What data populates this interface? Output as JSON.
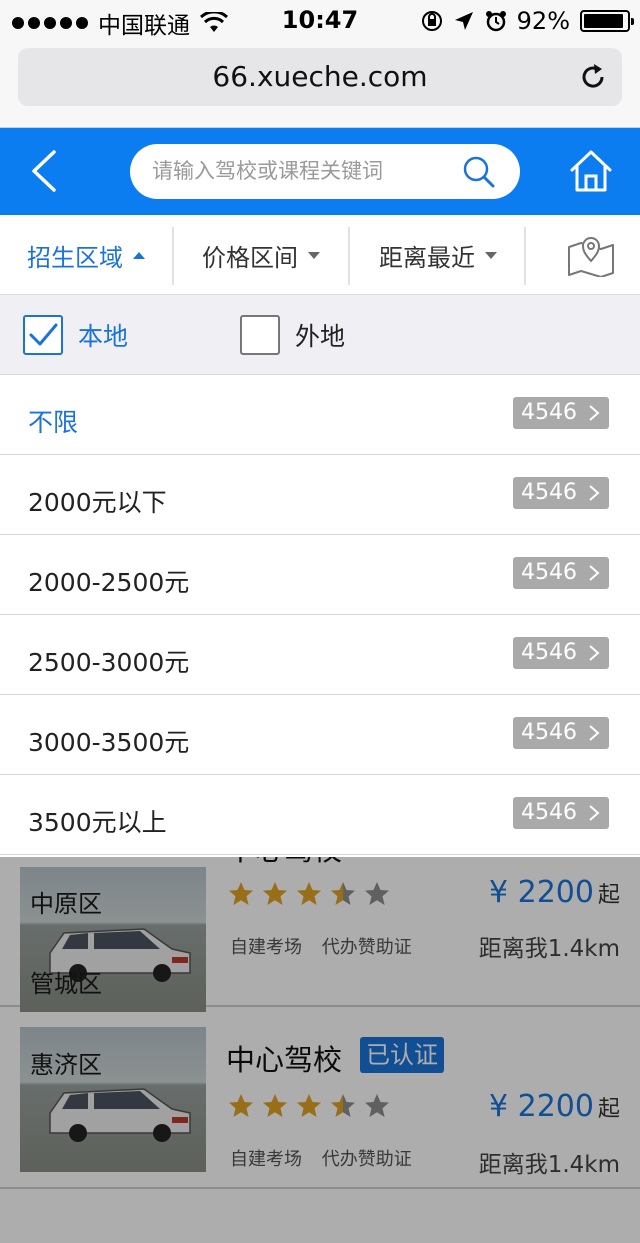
{
  "status_bar": {
    "carrier": "中国联通",
    "time": "10:47",
    "battery": "92%",
    "battery_level": 0.92
  },
  "browser": {
    "url": "66.xueche.com"
  },
  "header": {
    "search_placeholder": "请输入驾校或课程关键词"
  },
  "filters": {
    "tabs": [
      {
        "label": "招生区域"
      },
      {
        "label": "价格区间"
      },
      {
        "label": "距离最近"
      }
    ]
  },
  "location": {
    "local_label": "本地",
    "local_checked": true,
    "remote_label": "外地",
    "remote_checked": false
  },
  "options": [
    {
      "label": "不限",
      "count": "4546"
    },
    {
      "label": "2000元以下",
      "count": "4546"
    },
    {
      "label": "2000-2500元",
      "count": "4546"
    },
    {
      "label": "2500-3000元",
      "count": "4546"
    },
    {
      "label": "3000-3500元",
      "count": "4546"
    },
    {
      "label": "3500元以上",
      "count": "4546"
    }
  ],
  "listing": {
    "cards": [
      {
        "name": "中心驾校",
        "rating": 3.5,
        "tags": [
          "自建考场",
          "代办赞助证"
        ],
        "price": "¥ 2200",
        "price_suffix": "起",
        "distance": "距离我1.4km"
      },
      {
        "name": "中心驾校",
        "verified": "已认证",
        "rating": 3.5,
        "tags": [
          "自建考场",
          "代办赞助证"
        ],
        "price": "¥ 2200",
        "price_suffix": "起",
        "distance": "距离我1.4km"
      }
    ],
    "district_labels": [
      "中原区",
      "管城区",
      "惠济区"
    ]
  },
  "colors": {
    "brand_blue": "#0b7df0",
    "accent_blue": "#1a73d9",
    "star_gold": "#e2a224",
    "star_gray": "#8e8e8e",
    "badge_gray": "#a9a9a9"
  }
}
